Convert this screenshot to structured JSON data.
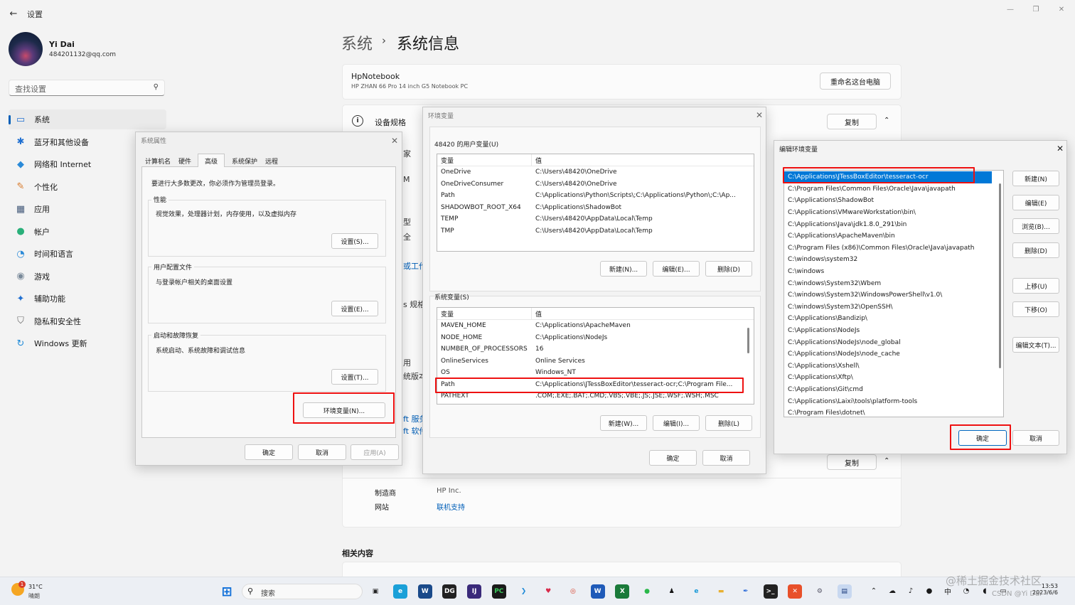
{
  "app": {
    "title": "设置",
    "back": "←"
  },
  "user": {
    "name": "Yi Dai",
    "email": "484201132@qq.com"
  },
  "search": {
    "placeholder": "查找设置"
  },
  "nav": [
    {
      "label": "系统",
      "icon": "▭",
      "color": "#1f6fd1"
    },
    {
      "label": "蓝牙和其他设备",
      "icon": "✱",
      "color": "#1f6fd1"
    },
    {
      "label": "网络和 Internet",
      "icon": "◆",
      "color": "#2a8ad8"
    },
    {
      "label": "个性化",
      "icon": "✎",
      "color": "#d87a2a"
    },
    {
      "label": "应用",
      "icon": "▦",
      "color": "#445a7a"
    },
    {
      "label": "帐户",
      "icon": "●",
      "color": "#2ab07a"
    },
    {
      "label": "时间和语言",
      "icon": "◔",
      "color": "#2a8ad8"
    },
    {
      "label": "游戏",
      "icon": "◉",
      "color": "#7a8a9a"
    },
    {
      "label": "辅助功能",
      "icon": "✦",
      "color": "#1f6fd1"
    },
    {
      "label": "隐私和安全性",
      "icon": "⛉",
      "color": "#6a6a6a"
    },
    {
      "label": "Windows 更新",
      "icon": "↻",
      "color": "#1f8ad8"
    }
  ],
  "breadcrumb": {
    "parent": "系统",
    "sep": "›",
    "current": "系统信息"
  },
  "pc": {
    "name": "HpNotebook",
    "model": "HP ZHAN 66 Pro 14 inch G5 Notebook PC",
    "rename": "重命名这台电脑"
  },
  "spec": {
    "title": "设备规格",
    "copy": "复制",
    "caret": "⌃",
    "copy2": "复制"
  },
  "peeks": [
    "家",
    "M",
    "型",
    "全",
    "或工作",
    "s 规格",
    "用",
    "统版本",
    "ft 服务",
    "ft 软件"
  ],
  "info": {
    "mfg_key": "制造商",
    "mfg_val": "HP Inc.",
    "web_key": "网站",
    "web_val": "联机支持"
  },
  "related": "相关内容",
  "sysprops": {
    "title": "系统属性",
    "tabs": [
      "计算机名",
      "硬件",
      "高级",
      "系统保护",
      "远程"
    ],
    "admin_note": "要进行大多数更改，你必须作为管理员登录。",
    "perf_label": "性能",
    "perf_desc": "视觉效果，处理器计划，内存使用，以及虚拟内存",
    "perf_btn": "设置(S)...",
    "profile_label": "用户配置文件",
    "profile_desc": "与登录帐户相关的桌面设置",
    "profile_btn": "设置(E)...",
    "startup_label": "启动和故障恢复",
    "startup_desc": "系统启动、系统故障和调试信息",
    "startup_btn": "设置(T)...",
    "env_btn": "环境变量(N)...",
    "ok": "确定",
    "cancel": "取消",
    "apply": "应用(A)"
  },
  "envvars": {
    "title": "环境变量",
    "user_label": "48420 的用户变量(U)",
    "col_var": "变量",
    "col_val": "值",
    "user_vars": [
      {
        "name": "OneDrive",
        "value": "C:\\Users\\48420\\OneDrive"
      },
      {
        "name": "OneDriveConsumer",
        "value": "C:\\Users\\48420\\OneDrive"
      },
      {
        "name": "Path",
        "value": "C:\\Applications\\Python\\Scripts\\;C:\\Applications\\Python\\;C:\\Ap..."
      },
      {
        "name": "SHADOWBOT_ROOT_X64",
        "value": "C:\\Applications\\ShadowBot"
      },
      {
        "name": "TEMP",
        "value": "C:\\Users\\48420\\AppData\\Local\\Temp"
      },
      {
        "name": "TMP",
        "value": "C:\\Users\\48420\\AppData\\Local\\Temp"
      }
    ],
    "user_new": "新建(N)...",
    "user_edit": "编辑(E)...",
    "user_delete": "删除(D)",
    "sys_label": "系统变量(S)",
    "sys_vars": [
      {
        "name": "MAVEN_HOME",
        "value": "C:\\Applications\\ApacheMaven"
      },
      {
        "name": "NODE_HOME",
        "value": "C:\\Applications\\NodeJs"
      },
      {
        "name": "NUMBER_OF_PROCESSORS",
        "value": "16"
      },
      {
        "name": "OnlineServices",
        "value": "Online Services"
      },
      {
        "name": "OS",
        "value": "Windows_NT"
      },
      {
        "name": "Path",
        "value": "C:\\Applications\\JTessBoxEditor\\tesseract-ocr;C:\\Program File..."
      },
      {
        "name": "PATHEXT",
        "value": ".COM;.EXE;.BAT;.CMD;.VBS;.VBE;.JS;.JSE;.WSF;.WSH;.MSC"
      }
    ],
    "sys_new": "新建(W)...",
    "sys_edit": "编辑(I)...",
    "sys_delete": "删除(L)",
    "ok": "确定",
    "cancel": "取消"
  },
  "editenv": {
    "title": "编辑环境变量",
    "paths": [
      "C:\\Applications\\JTessBoxEditor\\tesseract-ocr",
      "C:\\Program Files\\Common Files\\Oracle\\Java\\javapath",
      "C:\\Applications\\ShadowBot",
      "C:\\Applications\\VMwareWorkstation\\bin\\",
      "C:\\Applications\\Java\\jdk1.8.0_291\\bin",
      "C:\\Applications\\ApacheMaven\\bin",
      "C:\\Program Files (x86)\\Common Files\\Oracle\\Java\\javapath",
      "C:\\windows\\system32",
      "C:\\windows",
      "C:\\windows\\System32\\Wbem",
      "C:\\windows\\System32\\WindowsPowerShell\\v1.0\\",
      "C:\\windows\\System32\\OpenSSH\\",
      "C:\\Applications\\Bandizip\\",
      "C:\\Applications\\NodeJs",
      "C:\\Applications\\NodeJs\\node_global",
      "C:\\Applications\\NodeJs\\node_cache",
      "C:\\Applications\\Xshell\\",
      "C:\\Applications\\Xftp\\",
      "C:\\Applications\\Git\\cmd",
      "C:\\Applications\\Laixi\\tools\\platform-tools",
      "C:\\Program Files\\dotnet\\"
    ],
    "btn_new": "新建(N)",
    "btn_edit": "编辑(E)",
    "btn_browse": "浏览(B)...",
    "btn_delete": "删除(D)",
    "btn_up": "上移(U)",
    "btn_down": "下移(O)",
    "btn_edittext": "编辑文本(T)...",
    "ok": "确定",
    "cancel": "取消"
  },
  "taskbar": {
    "temp": "31°C",
    "weather": "晴朗",
    "badge": "1",
    "search": "搜索",
    "apps": [
      {
        "name": "start-icon",
        "glyph": "⊞",
        "bg": "#eceff4",
        "fg": "#0a6cd8"
      },
      {
        "name": "task-view-icon",
        "glyph": "▣",
        "bg": "#eceff4",
        "fg": "#222"
      },
      {
        "name": "browser-icon",
        "glyph": "e",
        "bg": "#1aa0d8",
        "fg": "#fff"
      },
      {
        "name": "wps-icon",
        "glyph": "W",
        "bg": "#1a4a8a",
        "fg": "#fff"
      },
      {
        "name": "datagrip-icon",
        "glyph": "DG",
        "bg": "#222",
        "fg": "#fff"
      },
      {
        "name": "intellij-icon",
        "glyph": "IJ",
        "bg": "#3a2a7a",
        "fg": "#fff"
      },
      {
        "name": "pycharm-icon",
        "glyph": "PC",
        "bg": "#1a1a1a",
        "fg": "#3ac85a"
      },
      {
        "name": "vscode-icon",
        "glyph": "❯",
        "bg": "#eceff4",
        "fg": "#1f8ad8"
      },
      {
        "name": "typora-icon",
        "glyph": "♥",
        "bg": "#eceff4",
        "fg": "#d82a4a"
      },
      {
        "name": "chrome-icon",
        "glyph": "◎",
        "bg": "#eceff4",
        "fg": "#d8402a"
      },
      {
        "name": "word-icon",
        "glyph": "W",
        "bg": "#1f5ab8",
        "fg": "#fff"
      },
      {
        "name": "excel-icon",
        "glyph": "X",
        "bg": "#1a7a3a",
        "fg": "#fff"
      },
      {
        "name": "wechat-icon",
        "glyph": "●",
        "bg": "#eceff4",
        "fg": "#2ab84a"
      },
      {
        "name": "qq-icon",
        "glyph": "♟",
        "bg": "#eceff4",
        "fg": "#111"
      },
      {
        "name": "edge-icon",
        "glyph": "e",
        "bg": "#eceff4",
        "fg": "#1a9ad8"
      },
      {
        "name": "folder-icon",
        "glyph": "▬",
        "bg": "#eceff4",
        "fg": "#e8b030"
      },
      {
        "name": "feather-icon",
        "glyph": "✒",
        "bg": "#eceff4",
        "fg": "#2a6ad8"
      },
      {
        "name": "terminal-icon",
        "glyph": ">_",
        "bg": "#222",
        "fg": "#fff"
      },
      {
        "name": "xmind-icon",
        "glyph": "✕",
        "bg": "#e8502a",
        "fg": "#fff"
      },
      {
        "name": "settings-icon",
        "glyph": "⚙",
        "bg": "#eceff4",
        "fg": "#556"
      },
      {
        "name": "sysprop-icon",
        "glyph": "▤",
        "bg": "#c8d8f0",
        "fg": "#1a3a7a"
      }
    ],
    "tray": [
      "⌃",
      "☁",
      "♪",
      "●",
      "中",
      "◔",
      "◖",
      "▭"
    ],
    "time": "13:53",
    "date": "2023/6/6"
  },
  "watermark": "@稀土掘金技术社区",
  "csdn": "CSDN @Yi Dai"
}
